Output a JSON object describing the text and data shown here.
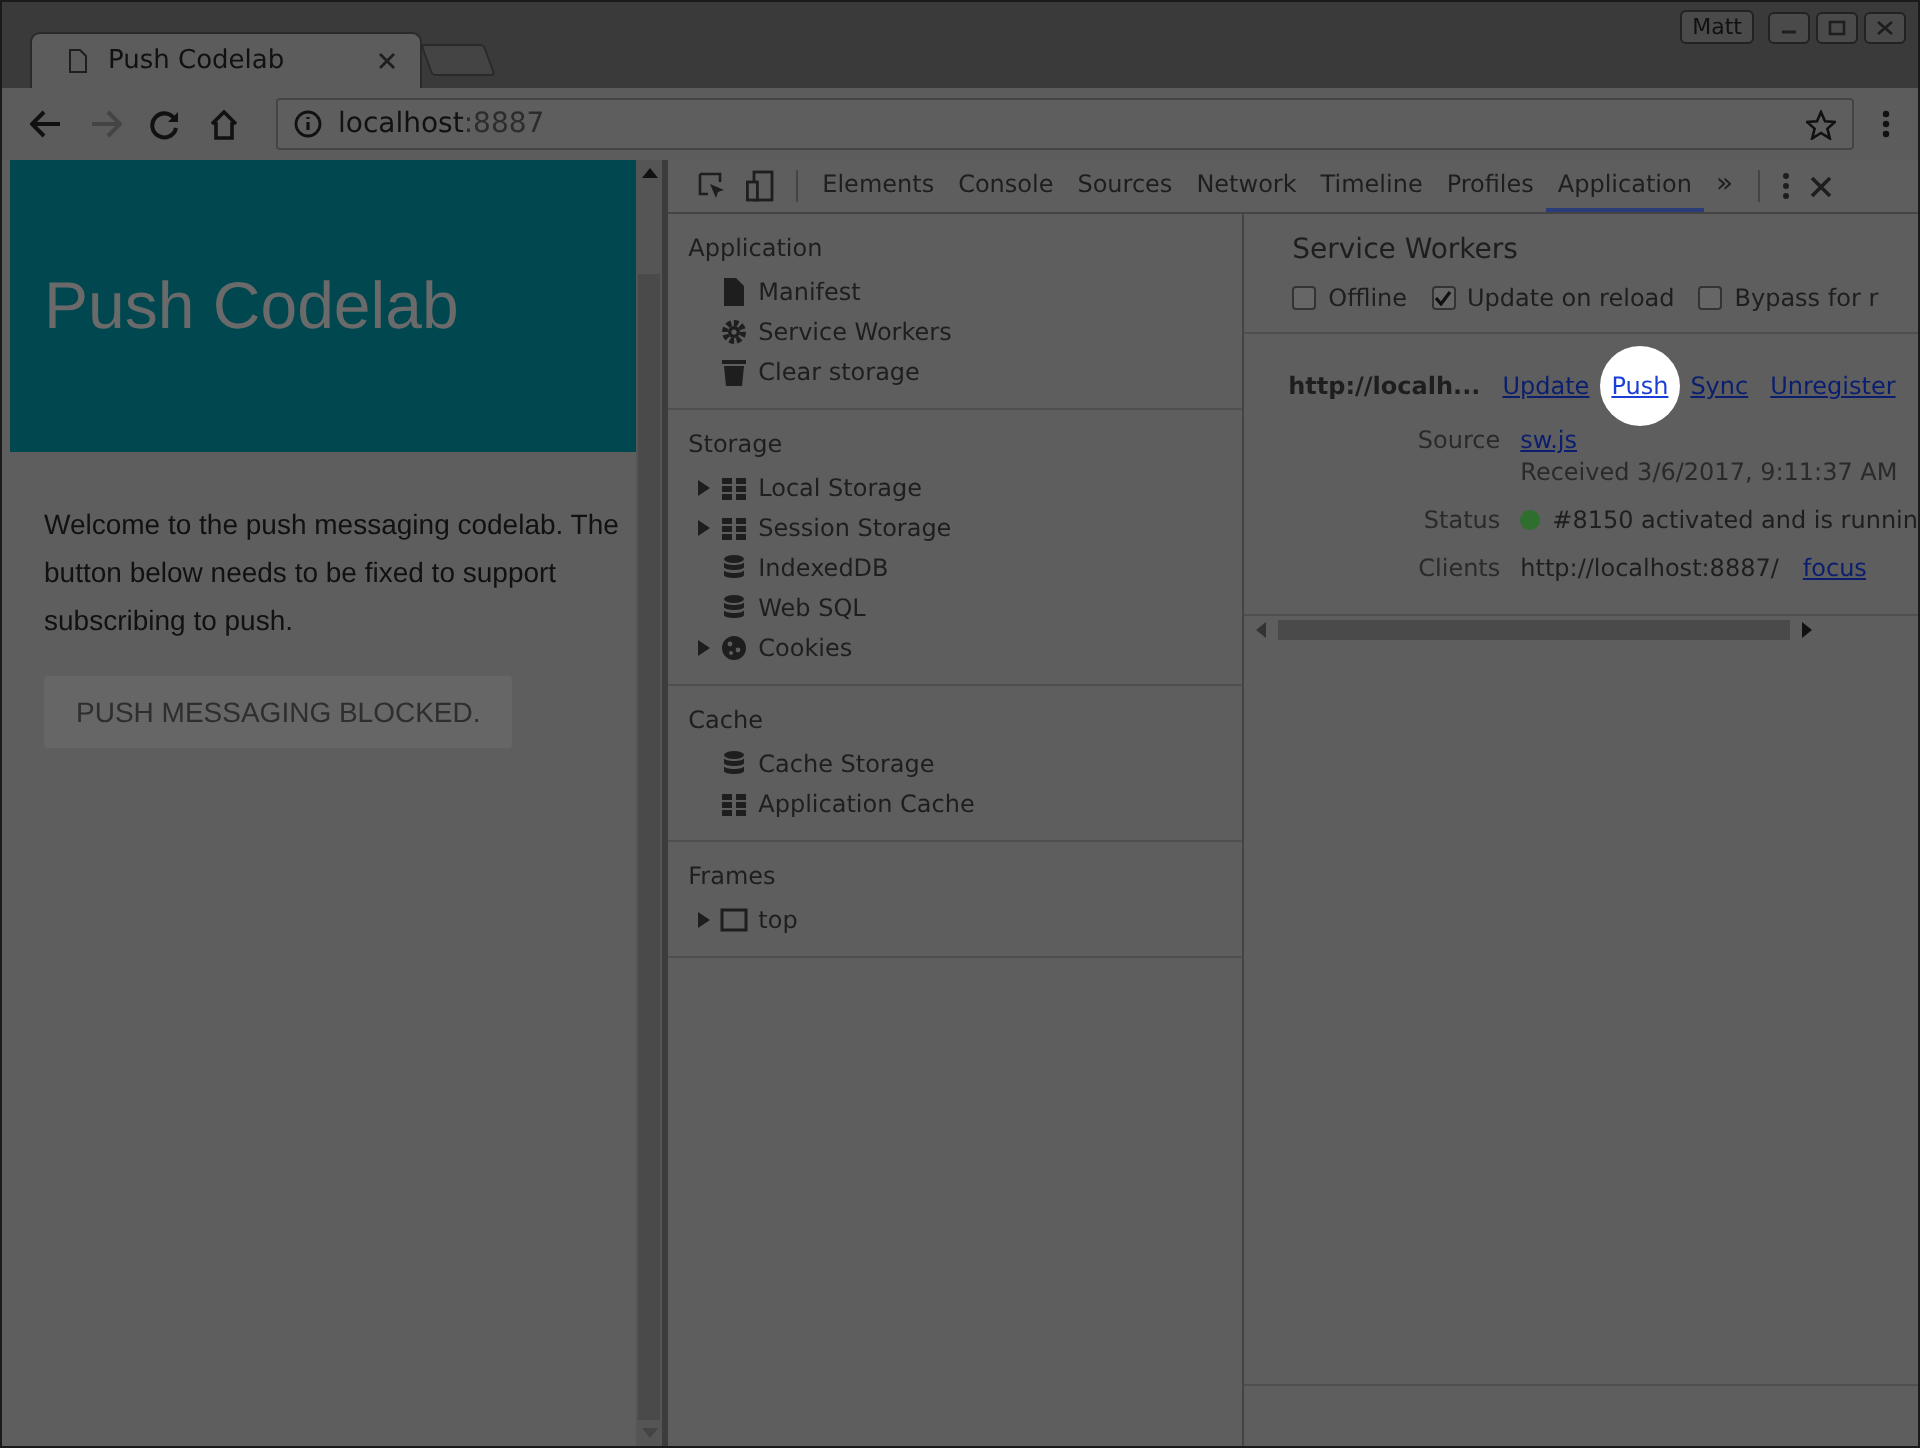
{
  "window": {
    "user": "Matt"
  },
  "tabs": [
    {
      "title": "Push Codelab",
      "selected": true
    }
  ],
  "toolbar": {
    "url_host": "localhost",
    "url_port": ":8887"
  },
  "page": {
    "title": "Push Codelab",
    "intro": "Welcome to the push messaging codelab. The button below needs to be fixed to support subscribing to push.",
    "button": "PUSH MESSAGING BLOCKED."
  },
  "devtools": {
    "tabs": [
      {
        "label": "Elements",
        "selected": false
      },
      {
        "label": "Console",
        "selected": false
      },
      {
        "label": "Sources",
        "selected": false
      },
      {
        "label": "Network",
        "selected": false
      },
      {
        "label": "Timeline",
        "selected": false
      },
      {
        "label": "Profiles",
        "selected": false
      },
      {
        "label": "Application",
        "selected": true
      }
    ],
    "overflow": "»",
    "sidebar": [
      {
        "title": "Application",
        "items": [
          {
            "label": "Manifest",
            "kind": "file",
            "expandable": false
          },
          {
            "label": "Service Workers",
            "kind": "gear",
            "expandable": false
          },
          {
            "label": "Clear storage",
            "kind": "trash",
            "expandable": false
          }
        ]
      },
      {
        "title": "Storage",
        "items": [
          {
            "label": "Local Storage",
            "kind": "grid",
            "expandable": true
          },
          {
            "label": "Session Storage",
            "kind": "grid",
            "expandable": true
          },
          {
            "label": "IndexedDB",
            "kind": "database",
            "expandable": false
          },
          {
            "label": "Web SQL",
            "kind": "database",
            "expandable": false
          },
          {
            "label": "Cookies",
            "kind": "cookie",
            "expandable": true
          }
        ]
      },
      {
        "title": "Cache",
        "items": [
          {
            "label": "Cache Storage",
            "kind": "database",
            "expandable": false
          },
          {
            "label": "Application Cache",
            "kind": "grid",
            "expandable": false
          }
        ]
      },
      {
        "title": "Frames",
        "items": [
          {
            "label": "top",
            "kind": "frame",
            "expandable": true
          }
        ]
      }
    ],
    "panel": {
      "title": "Service Workers",
      "options": [
        {
          "label": "Offline",
          "checked": false
        },
        {
          "label": "Update on reload",
          "checked": true
        },
        {
          "label": "Bypass for r",
          "checked": false
        }
      ],
      "worker": {
        "origin": "http://localh...",
        "links": [
          {
            "label": "Update",
            "highlighted": false
          },
          {
            "label": "Push",
            "highlighted": true
          },
          {
            "label": "Sync",
            "highlighted": false
          },
          {
            "label": "Unregister",
            "highlighted": false
          }
        ],
        "source_label": "Source",
        "source": "sw.js",
        "received": "Received 3/6/2017, 9:11:37 AM",
        "status_label": "Status",
        "status": "#8150 activated and is runnin",
        "clients_label": "Clients",
        "client": "http://localhost:8887/",
        "focus": "focus"
      }
    }
  }
}
